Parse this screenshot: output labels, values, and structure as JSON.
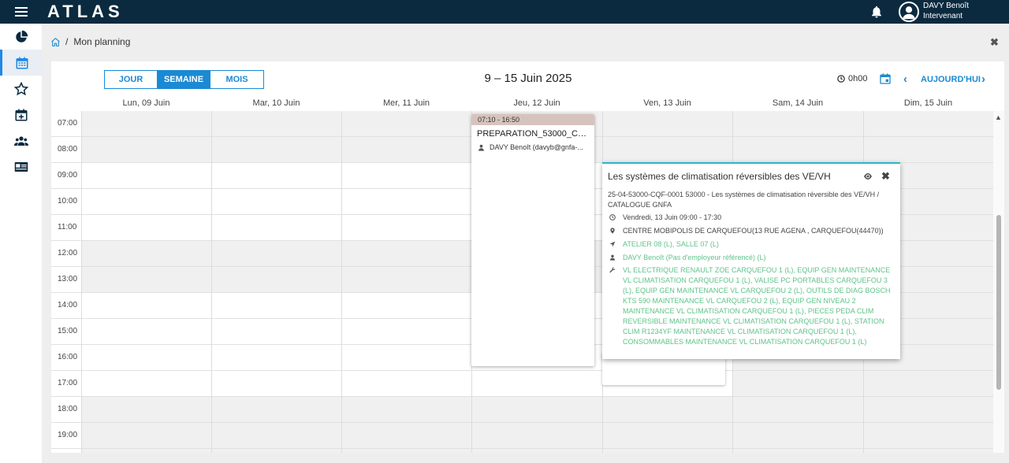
{
  "app": {
    "logo": "ATLAS"
  },
  "user": {
    "name": "DAVY Benoît",
    "role": "Intervenant"
  },
  "breadcrumb": {
    "page": "Mon planning"
  },
  "calendar": {
    "views": [
      "JOUR",
      "SEMAINE",
      "MOIS"
    ],
    "active_view": "SEMAINE",
    "title": "9 – 15 Juin 2025",
    "total_hours": "0h00",
    "today_label": "AUJOURD'HUI",
    "days": [
      "Lun, 09 Juin",
      "Mar, 10 Juin",
      "Mer, 11 Juin",
      "Jeu, 12 Juin",
      "Ven, 13 Juin",
      "Sam, 14 Juin",
      "Dim, 15 Juin"
    ],
    "hours": [
      "07:00",
      "08:00",
      "09:00",
      "10:00",
      "11:00",
      "12:00",
      "13:00",
      "14:00",
      "15:00",
      "16:00",
      "17:00",
      "18:00",
      "19:00"
    ]
  },
  "event": {
    "time": "07:10 - 16:50",
    "title": "PREPARATION_53000_CQF...",
    "person": "DAVY Benoît (davyb@gnfa-..."
  },
  "popup": {
    "title": "Les systèmes de climatisation réversibles des VE/VH",
    "reference": "25-04-53000-CQF-0001 53000 - Les systèmes de climatisation réversible des VE/VH / CATALOGUE GNFA",
    "datetime": "Vendredi, 13 Juin 09:00 - 17:30",
    "location": "CENTRE MOBIPOLIS DE CARQUEFOU(13 RUE AGENA , CARQUEFOU(44470))",
    "rooms": "ATELIER 08 (L), SALLE 07 (L)",
    "trainer": "DAVY Benoît (Pas d'employeur référencé) (L)",
    "equipment": "VL ELECTRIQUE RENAULT ZOE CARQUEFOU 1 (L), EQUIP GEN MAINTENANCE VL CLIMATISATION CARQUEFOU 1 (L), VALISE PC PORTABLES CARQUEFOU 3 (L), EQUIP GEN MAINTENANCE VL CARQUEFOU 2 (L), OUTILS DE DIAG BOSCH KTS 590 MAINTENANCE VL CARQUEFOU 2 (L), EQUIP GEN NIVEAU 2 MAINTENANCE VL CLIMATISATION CARQUEFOU 1 (L), PIECES PEDA CLIM REVERSIBLE MAINTENANCE VL CLIMATISATION CARQUEFOU 1 (L), STATION CLIM R1234YF MAINTENANCE VL CLIMATISATION CARQUEFOU 1 (L), CONSOMMABLES MAINTENANCE VL CLIMATISATION CARQUEFOU 1 (L)"
  },
  "icons": [
    "menu-icon",
    "bell-icon",
    "user-avatar-icon",
    "dashboard-icon",
    "calendar-icon",
    "star-icon",
    "calendar-add-icon",
    "users-icon",
    "id-card-icon",
    "home-icon",
    "clock-icon",
    "location-icon",
    "navigation-icon",
    "person-icon",
    "wrench-icon",
    "eye-icon",
    "close-icon"
  ],
  "colors": {
    "topbar": "#0b2a3f",
    "accent": "#1a8ad4",
    "event_header": "#d7c3bd",
    "popup_border": "#2eb5c9",
    "resource_green": "#5fc389"
  }
}
